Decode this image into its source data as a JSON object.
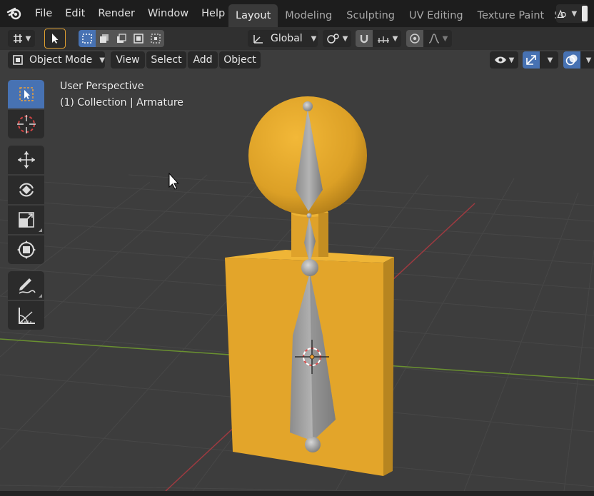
{
  "topbar": {
    "menus": [
      "File",
      "Edit",
      "Render",
      "Window",
      "Help"
    ],
    "workspaces": [
      {
        "label": "Layout",
        "active": true
      },
      {
        "label": "Modeling",
        "active": false
      },
      {
        "label": "Sculpting",
        "active": false
      },
      {
        "label": "UV Editing",
        "active": false
      },
      {
        "label": "Texture Paint",
        "active": false
      },
      {
        "label": "S",
        "active": false
      }
    ]
  },
  "toolheader": {
    "transform_orientation": "Global"
  },
  "viewport_header": {
    "mode": "Object Mode",
    "menus": [
      "View",
      "Select",
      "Add",
      "Object"
    ]
  },
  "viewport": {
    "perspective_label": "User Perspective",
    "collection_label": "(1) Collection | Armature"
  },
  "colors": {
    "accent": "#4772b3",
    "mesh": "#e0a72a",
    "bone": "#9a9a9a",
    "grid": "#474747",
    "x_axis": "#9e3a40",
    "y_axis": "#6a9130"
  },
  "icons": {
    "logo": "blender-logo-icon",
    "select_box": "select-box-icon",
    "cursor": "cursor-icon",
    "move": "move-icon",
    "rotate": "rotate-icon",
    "scale": "scale-icon",
    "transform": "transform-icon",
    "annotate": "annotate-icon",
    "measure": "measure-icon"
  }
}
